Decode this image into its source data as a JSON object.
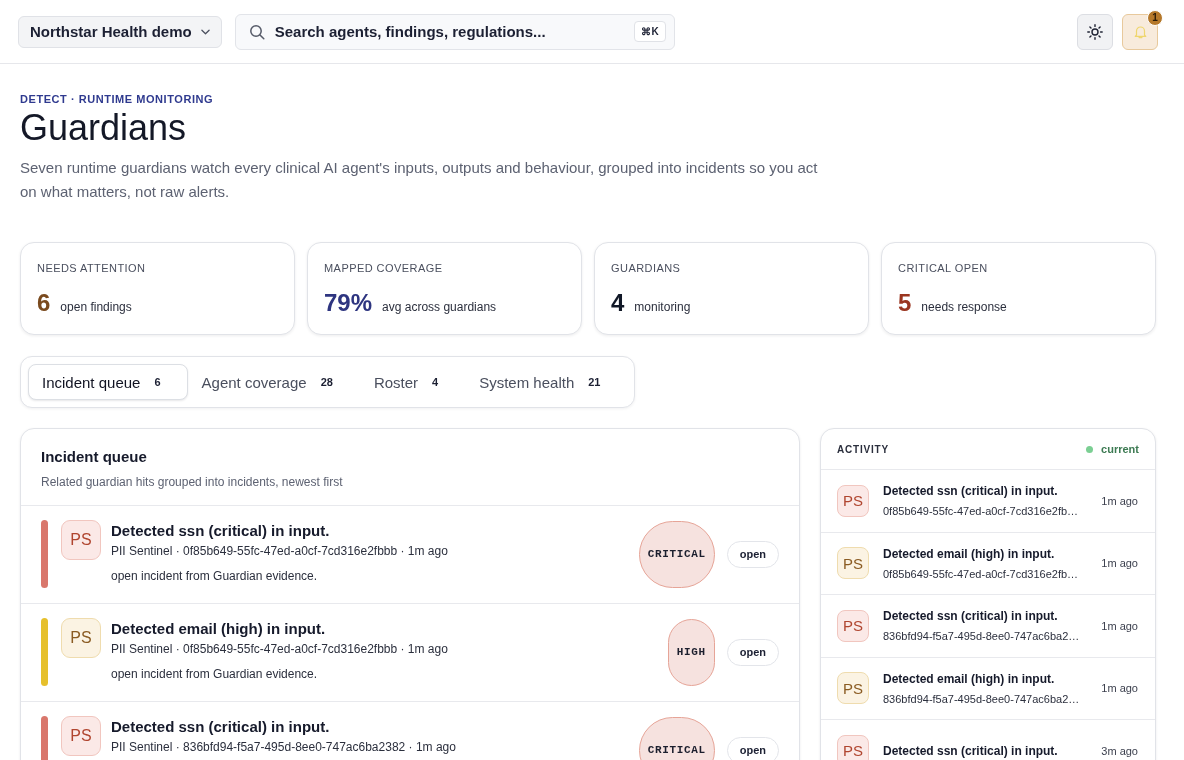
{
  "top_bar": {
    "workspace": "Northstar Health demo",
    "search": {
      "placeholder": "Search agents, findings, regulations...",
      "shortcut": "⌘K"
    },
    "notifications": {
      "count": "1"
    }
  },
  "header": {
    "eyebrow": "DETECT · RUNTIME MONITORING",
    "title": "Guardians",
    "description": "Seven runtime guardians watch every clinical AI agent's inputs, outputs and behaviour, grouped into incidents so you act on what matters, not raw alerts."
  },
  "stats": [
    {
      "label": "NEEDS ATTENTION",
      "value": "6",
      "suffix": "open findings",
      "color": "#7a4a1e"
    },
    {
      "label": "MAPPED COVERAGE",
      "value": "79%",
      "suffix": "avg across guardians",
      "color": "#2e3580"
    },
    {
      "label": "GUARDIANS",
      "value": "4",
      "suffix": "monitoring",
      "color": "#111827"
    },
    {
      "label": "CRITICAL OPEN",
      "value": "5",
      "suffix": "needs response",
      "color": "#9a3520"
    }
  ],
  "tabs": [
    {
      "label": "Incident queue",
      "count": "6",
      "selected": true
    },
    {
      "label": "Agent coverage",
      "count": "28",
      "selected": false
    },
    {
      "label": "Roster",
      "count": "4",
      "selected": false
    },
    {
      "label": "System health",
      "count": "21",
      "selected": false
    }
  ],
  "incident_queue": {
    "title": "Incident queue",
    "subtitle": "Related guardian hits grouped into incidents, newest first",
    "incidents": [
      {
        "kind": "critical",
        "avatar": "PS",
        "title": "Detected ssn (critical) in input.",
        "meta": "PII Sentinel · 0f85b649-55fc-47ed-a0cf-7cd316e2fbbb · 1m ago",
        "note": "open incident from Guardian evidence.",
        "severity": "CRITICAL",
        "status": "open"
      },
      {
        "kind": "high",
        "avatar": "PS",
        "title": "Detected email (high) in input.",
        "meta": "PII Sentinel · 0f85b649-55fc-47ed-a0cf-7cd316e2fbbb · 1m ago",
        "note": "open incident from Guardian evidence.",
        "severity": "HIGH",
        "status": "open"
      },
      {
        "kind": "critical",
        "avatar": "PS",
        "title": "Detected ssn (critical) in input.",
        "meta": "PII Sentinel · 836bfd94-f5a7-495d-8ee0-747ac6ba2382 · 1m ago",
        "severity": "CRITICAL",
        "status": "open"
      }
    ]
  },
  "activity": {
    "title": "ACTIVITY",
    "status": "current",
    "items": [
      {
        "kind": "critical",
        "avatar": "PS",
        "title": "Detected ssn (critical) in input.",
        "id": "0f85b649-55fc-47ed-a0cf-7cd316e2fb…",
        "time": "1m ago"
      },
      {
        "kind": "high",
        "avatar": "PS",
        "title": "Detected email (high) in input.",
        "id": "0f85b649-55fc-47ed-a0cf-7cd316e2fb…",
        "time": "1m ago"
      },
      {
        "kind": "critical",
        "avatar": "PS",
        "title": "Detected ssn (critical) in input.",
        "id": "836bfd94-f5a7-495d-8ee0-747ac6ba2…",
        "time": "1m ago"
      },
      {
        "kind": "high",
        "avatar": "PS",
        "title": "Detected email (high) in input.",
        "id": "836bfd94-f5a7-495d-8ee0-747ac6ba2…",
        "time": "1m ago"
      },
      {
        "kind": "critical",
        "avatar": "PS",
        "title": "Detected ssn (critical) in input.",
        "time": "3m ago"
      }
    ]
  }
}
